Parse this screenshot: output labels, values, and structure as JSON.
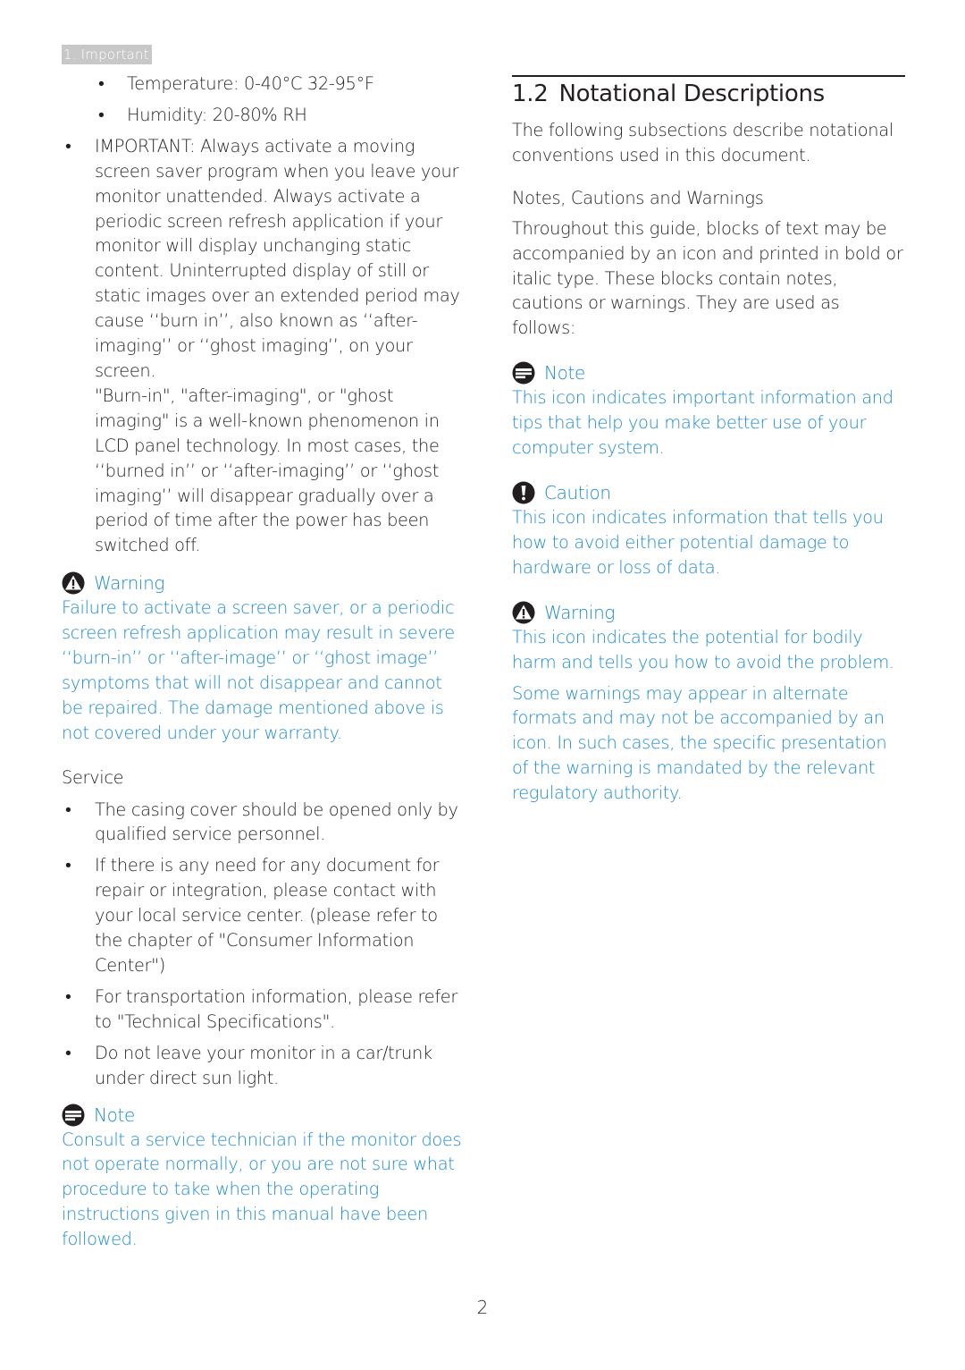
{
  "header_tag": "1. Important",
  "left": {
    "env_items": [
      "Temperature: 0-40°C 32-95°F",
      "Humidity: 20-80% RH"
    ],
    "important_bullet": "IMPORTANT: Always activate a moving screen saver program when you leave your monitor unattended. Always activate a periodic screen refresh application if your monitor will display unchanging static content. Uninterrupted display of still or static images over an extended period may cause ‘‘burn in’’, also known as ‘‘after-imaging’’ or ‘‘ghost imaging’’, on your screen.",
    "important_continuation": "\"Burn-in\", \"after-imaging\", or \"ghost imaging\" is a well-known phenomenon in LCD panel technology. In most cases, the ‘‘burned in’’ or ‘‘after-imaging’’ or ‘‘ghost imaging’’ will disappear gradually over a period of time after the power has been switched off.",
    "warning": {
      "icon": "warning-triangle-icon",
      "title": "Warning",
      "text": "Failure to activate a screen saver, or a periodic screen refresh application may result in severe ‘‘burn-in’’ or ‘‘after-image’’ or ‘‘ghost image’’ symptoms that will not disappear and cannot be repaired. The damage mentioned above is not covered under your warranty."
    },
    "service": {
      "heading": "Service",
      "items": [
        "The casing cover should be opened only by qualified service personnel.",
        "If there is any need for any document for repair or integration, please contact with your local service center. (please refer to the chapter of \"Consumer Information Center\")",
        "For transportation information, please refer to \"Technical Specifications\".",
        "Do not leave your monitor in a car/trunk under direct sun light."
      ]
    },
    "note": {
      "icon": "note-icon",
      "title": "Note",
      "text": "Consult a service technician if the monitor does not operate normally, or you are not sure what procedure to take when the operating instructions given in this manual have been followed."
    }
  },
  "right": {
    "section_number": "1.2",
    "section_title": "Notational Descriptions",
    "intro": "The following subsections describe notational conventions used in this document.",
    "subheading": "Notes, Cautions and Warnings",
    "description": "Throughout this guide, blocks of text may be accompanied by an icon and printed in bold or italic type. These blocks contain notes, cautions or warnings. They are used as follows:",
    "note": {
      "icon": "note-icon",
      "title": "Note",
      "text": "This icon indicates important information and tips that help you make better use of your computer system."
    },
    "caution": {
      "icon": "caution-exclamation-icon",
      "title": "Caution",
      "text": "This icon indicates information that tells you how to avoid either potential damage to hardware or loss of data."
    },
    "warning": {
      "icon": "warning-triangle-icon",
      "title": "Warning",
      "text": "This icon indicates the potential for bodily harm and tells you how to avoid the problem."
    },
    "alternate_formats": "Some warnings may appear in alternate formats and may not be accompanied by an icon. In such cases, the specific presentation of the warning is mandated by the relevant regulatory authority."
  },
  "page_number": "2",
  "colors": {
    "accent_blue": "#1c8ad1",
    "text": "#231f20",
    "tag_bg": "#c8c8c8"
  }
}
